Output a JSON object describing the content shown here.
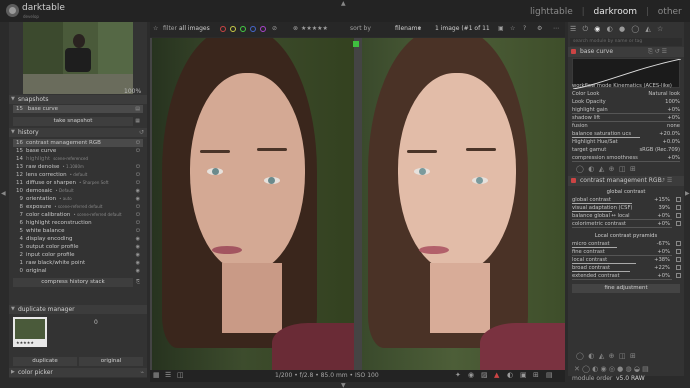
{
  "app": {
    "name": "darktable",
    "version_sub": "develop",
    "views": [
      "lighttable",
      "darkroom",
      "other"
    ],
    "active_view": "darkroom"
  },
  "navigation": {
    "zoom": "100%"
  },
  "snapshots": {
    "title": "snapshots",
    "item_num": "15",
    "item_label": "base curve",
    "take_label": "take snapshot"
  },
  "history": {
    "title": "history",
    "items": [
      {
        "num": "16",
        "label": "contrast management RGB",
        "sub": ""
      },
      {
        "num": "15",
        "label": "base curve",
        "sub": ""
      },
      {
        "num": "14",
        "label": "highlight",
        "sub": "scene-referenced"
      },
      {
        "num": "13",
        "label": "raw denoise",
        "sub": "• 1.1080m"
      },
      {
        "num": "12",
        "label": "lens correction",
        "sub": "• default"
      },
      {
        "num": "11",
        "label": "diffuse or sharpen",
        "sub": "• Sharpen Soft"
      },
      {
        "num": "10",
        "label": "demosaic",
        "sub": "• Default"
      },
      {
        "num": "9",
        "label": "orientation",
        "sub": "• auto"
      },
      {
        "num": "8",
        "label": "exposure",
        "sub": "• scene-referred default"
      },
      {
        "num": "7",
        "label": "color calibration",
        "sub": "• scene-referred default"
      },
      {
        "num": "6",
        "label": "highlight reconstruction",
        "sub": ""
      },
      {
        "num": "5",
        "label": "white balance",
        "sub": ""
      },
      {
        "num": "4",
        "label": "display encoding",
        "sub": ""
      },
      {
        "num": "3",
        "label": "output color profile",
        "sub": ""
      },
      {
        "num": "2",
        "label": "input color profile",
        "sub": ""
      },
      {
        "num": "1",
        "label": "raw black/white point",
        "sub": ""
      },
      {
        "num": "0",
        "label": "original",
        "sub": ""
      }
    ],
    "compress_label": "compress history stack"
  },
  "duplicate": {
    "title": "duplicate manager",
    "count": "0",
    "duplicate_label": "duplicate",
    "original_label": "original"
  },
  "color_picker": {
    "title": "color picker"
  },
  "filterbar": {
    "filter_label": "filter",
    "filter_value": "all images",
    "rating": "★★★★★",
    "sort_label": "sort by",
    "sort_value": "filename",
    "count_text": "1 image (#1 of 11"
  },
  "bottombar": {
    "exif": "1/200 • f/2.8 • 85.0 mm • ISO 100"
  },
  "right": {
    "search_placeholder": "search module by name or tag",
    "base_curve": {
      "title": "base curve",
      "rows": [
        {
          "label": "workflow mode Kinematics (ACES-like)",
          "value": ""
        },
        {
          "label": "Color Look",
          "value": "Natural look"
        },
        {
          "label": "Look Opacity",
          "value": "100%"
        },
        {
          "label": "highlight gain",
          "value": "+0%"
        },
        {
          "label": "shadow lift",
          "value": "+0%"
        },
        {
          "label": "fusion",
          "value": "none"
        },
        {
          "label": "balance saturation ucs",
          "value": "+20.0%"
        },
        {
          "label": "Highlight Hue/Sat",
          "value": "+0.0%"
        },
        {
          "label": "target gamut",
          "value": "sRGB (Rec.709)"
        },
        {
          "label": "compression smoothness",
          "value": "+0%"
        }
      ]
    },
    "contrast": {
      "title": "contrast management RGB",
      "global_title": "global contrast",
      "global_rows": [
        {
          "label": "global contrast",
          "value": "+15%"
        },
        {
          "label": "visual adaptation (CSF)",
          "value": "39%"
        },
        {
          "label": "balance global ↔ local",
          "value": "+0%"
        },
        {
          "label": "colorimetric contrast",
          "value": "+0%"
        }
      ],
      "local_title": "Local contrast pyramids",
      "local_rows": [
        {
          "label": "micro contrast",
          "value": "-67%"
        },
        {
          "label": "fine contrast",
          "value": "+0%"
        },
        {
          "label": "local contrast",
          "value": "+38%"
        },
        {
          "label": "broad contrast",
          "value": "+22%"
        },
        {
          "label": "extended contrast",
          "value": "+0%"
        }
      ],
      "fine_adjust_label": "fine adjustment"
    },
    "module_order_label": "module order",
    "module_order_value": "v5.0 RAW"
  },
  "colors": {
    "accent_green": "#3fbf3f",
    "panel_bg": "#333333"
  }
}
